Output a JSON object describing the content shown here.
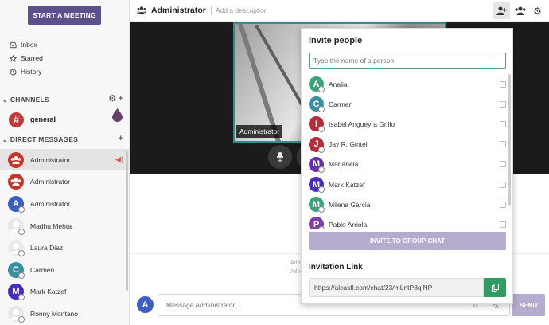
{
  "sidebar": {
    "start_meeting": "START A MEETING",
    "nav": [
      {
        "label": "Inbox",
        "icon": "inbox-icon"
      },
      {
        "label": "Starred",
        "icon": "star-icon"
      },
      {
        "label": "History",
        "icon": "history-icon"
      }
    ],
    "channels_title": "CHANNELS",
    "channels": [
      {
        "label": "general",
        "avatar": "#",
        "color": "#c13b3b"
      }
    ],
    "dm_title": "DIRECT MESSAGES",
    "dms": [
      {
        "label": "Administrator",
        "avatar": "group",
        "color": "#c0392b",
        "active": true
      },
      {
        "label": "Administrator",
        "avatar": "group",
        "color": "#c0392b"
      },
      {
        "label": "Administrator",
        "avatar": "A",
        "color": "#3b5fc0"
      },
      {
        "label": "Madhu Mehta",
        "avatar": "person",
        "color": "#d5d5d5"
      },
      {
        "label": "Laura Diaz",
        "avatar": "person",
        "color": "#d5d5d5"
      },
      {
        "label": "Carmen",
        "avatar": "C",
        "color": "#3a8fa1"
      },
      {
        "label": "Mark Katzef",
        "avatar": "M",
        "color": "#4a2bbd"
      },
      {
        "label": "Ronny Montano",
        "avatar": "person",
        "color": "#d5d5d5"
      }
    ]
  },
  "header": {
    "title": "Administrator",
    "description_placeholder": "Add a description"
  },
  "video": {
    "participant": "Administrator"
  },
  "system_messages": [
    "Adm",
    "Adm"
  ],
  "composer": {
    "avatar": "A",
    "placeholder": "Message Administrator...",
    "send_label": "SEND"
  },
  "invite": {
    "title": "Invite people",
    "search_placeholder": "Type the name of a person",
    "people": [
      {
        "name": "Analia",
        "initial": "A",
        "color": "#3aa37a"
      },
      {
        "name": "Carmen",
        "initial": "C",
        "color": "#3a8fa1"
      },
      {
        "name": "Isabel Angueyra Grillo",
        "initial": "I",
        "color": "#b22f3a"
      },
      {
        "name": "Jay R. Gintel",
        "initial": "J",
        "color": "#b22f3a"
      },
      {
        "name": "Marianela",
        "initial": "M",
        "color": "#6a2fa8"
      },
      {
        "name": "Mark Katzef",
        "initial": "M",
        "color": "#4a2bbd"
      },
      {
        "name": "Milena Garcia",
        "initial": "M",
        "color": "#3aa37a"
      },
      {
        "name": "Pablo Arriola",
        "initial": "P",
        "color": "#7b3fa8"
      }
    ],
    "invite_button": "INVITE TO GROUP CHAT",
    "link_title": "Invitation Link",
    "link_value": "https://alcasfl.com/chat/23/mLntP3qiNP"
  }
}
